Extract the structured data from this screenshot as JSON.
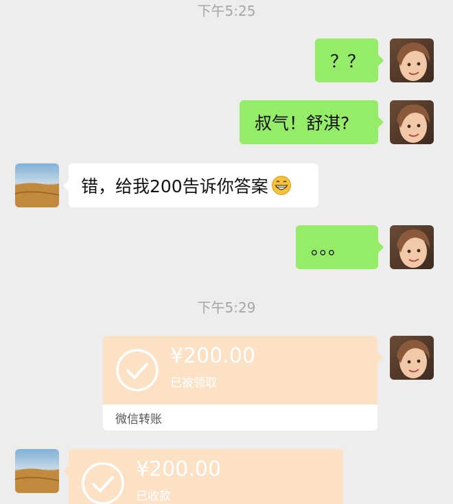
{
  "timestamps": [
    "下午5:25",
    "下午5:29"
  ],
  "messages": [
    {
      "text": "？？"
    },
    {
      "text": "叔气！舒淇?"
    },
    {
      "text": "错，给我200告诉你答案"
    },
    {
      "text": "。。。"
    }
  ],
  "emoji_name": "grinning-face-icon",
  "transfers": [
    {
      "amount": "¥200.00",
      "status": "已被领取",
      "footer": "微信转账"
    },
    {
      "amount": "¥200.00",
      "status": "已收款"
    }
  ],
  "colors": {
    "background": "#ededed",
    "sent_bubble": "#95ec69",
    "received_bubble": "#ffffff",
    "transfer_card": "#fde1c5",
    "timestamp_text": "#a6a6a6"
  }
}
